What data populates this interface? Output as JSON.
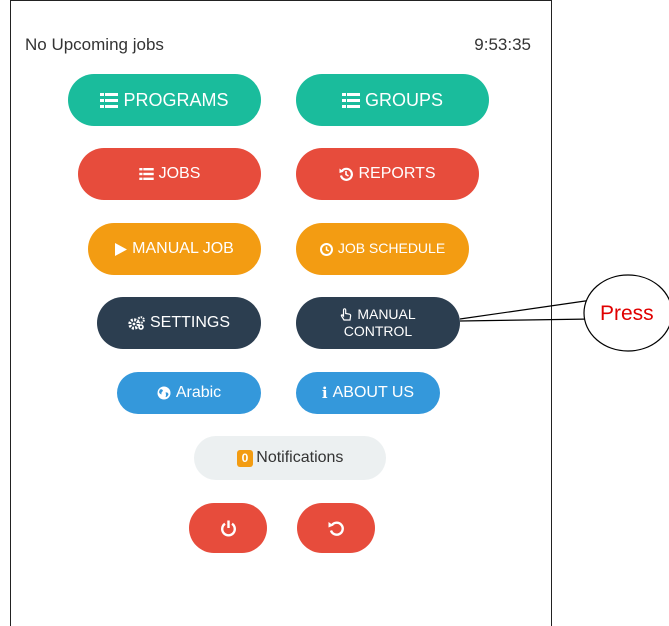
{
  "status": {
    "upcoming": "No Upcoming jobs",
    "clock": "9:53:35"
  },
  "buttons": {
    "programs": "PROGRAMS",
    "groups": "GROUPS",
    "jobs": "JOBS",
    "reports": "REPORTS",
    "manual_job": "MANUAL JOB",
    "job_schedule": "JOB SCHEDULE",
    "settings": "SETTINGS",
    "manual_control_1": "MANUAL",
    "manual_control_2": "CONTROL",
    "language": "Arabic",
    "about": "ABOUT US",
    "notifications_count": "0",
    "notifications": "Notifications"
  },
  "callout": {
    "text": "Press"
  },
  "colors": {
    "teal": "#1abc9c",
    "red": "#e74c3c",
    "orange": "#f39c12",
    "navy": "#2c3e50",
    "blue": "#3498db",
    "light": "#ecf0f1"
  },
  "icons": {
    "programs": "list-icon",
    "groups": "list-icon",
    "jobs": "list-icon",
    "reports": "history-icon",
    "manual_job": "play-icon",
    "job_schedule": "clock-icon",
    "settings": "gears-icon",
    "manual_control": "hand-pointer-icon",
    "language": "globe-icon",
    "about": "info-icon",
    "power": "power-icon",
    "restart": "restart-icon"
  }
}
